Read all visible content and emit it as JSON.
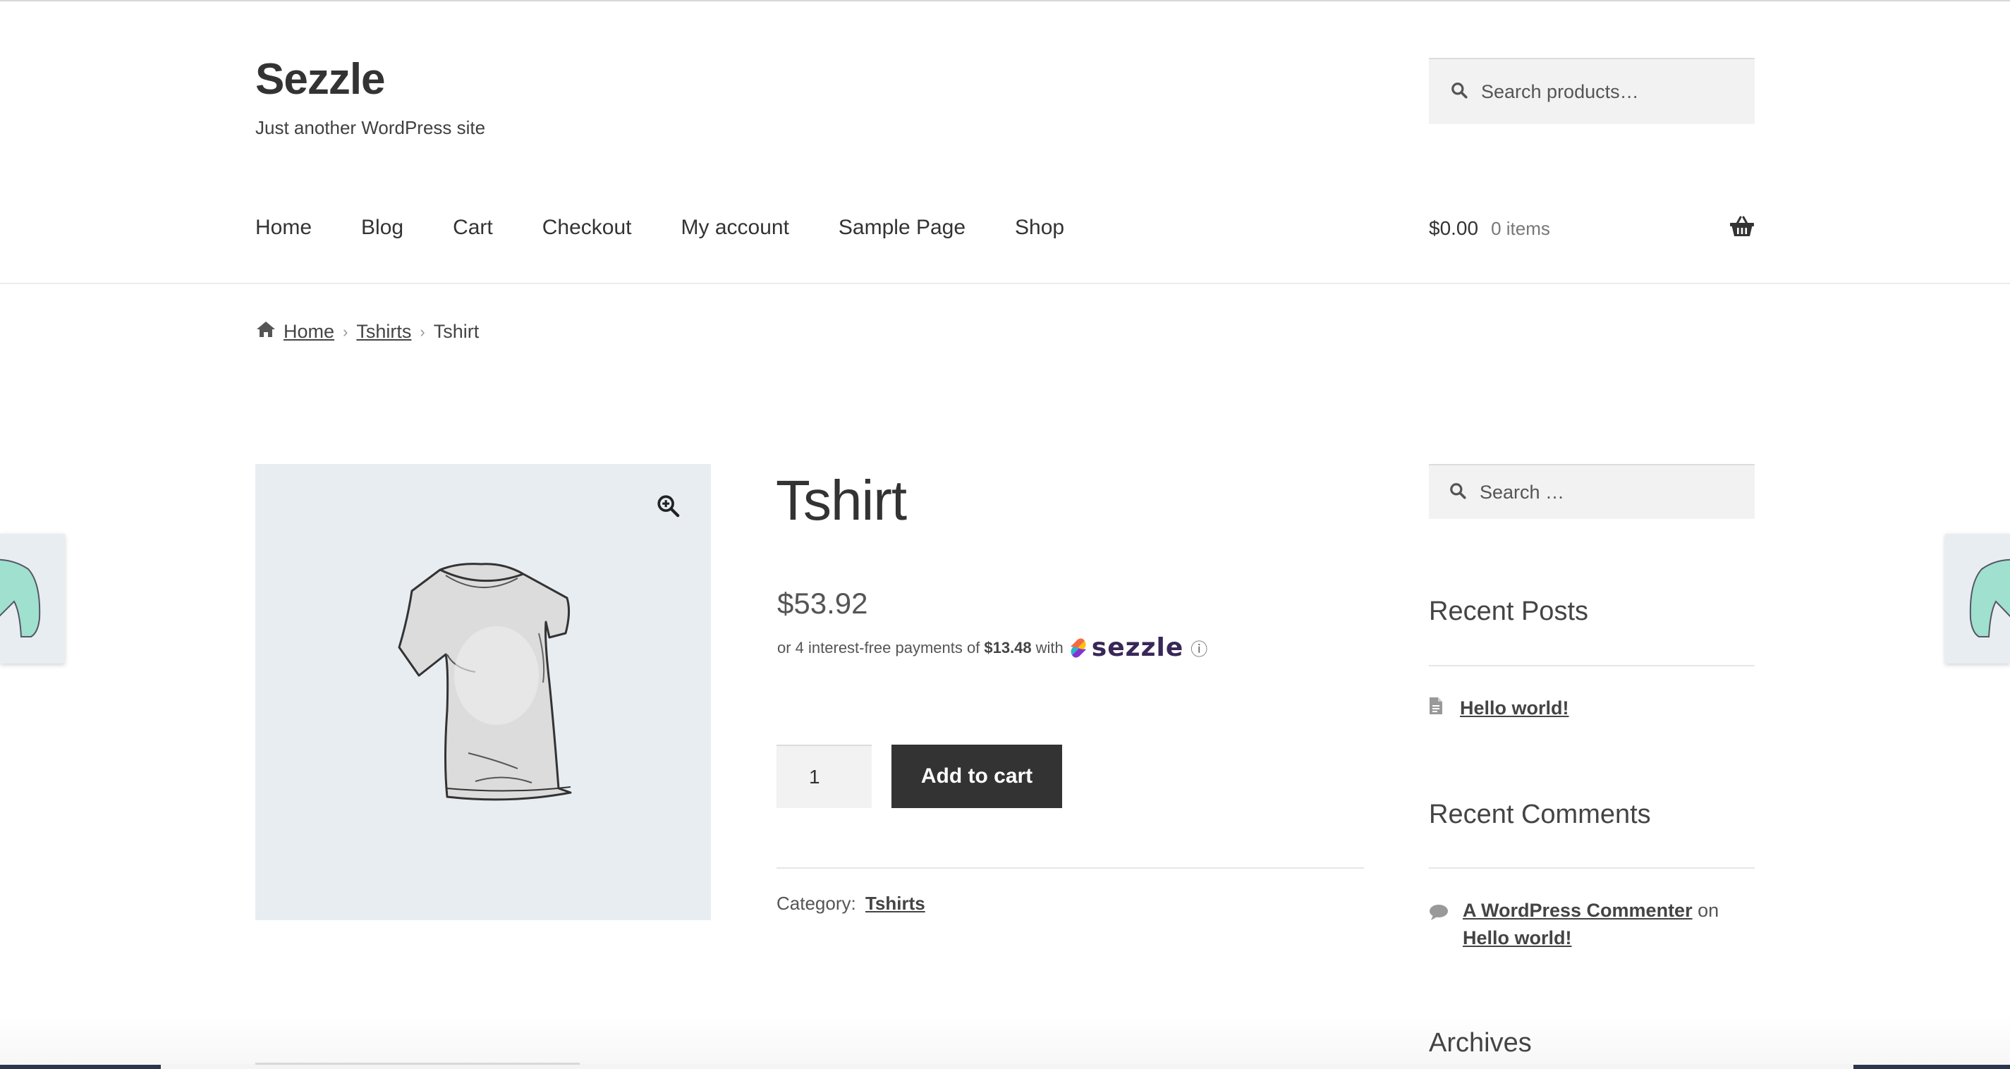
{
  "site": {
    "title": "Sezzle",
    "tagline": "Just another WordPress site"
  },
  "header_search": {
    "placeholder": "Search products…"
  },
  "nav": {
    "items": [
      "Home",
      "Blog",
      "Cart",
      "Checkout",
      "My account",
      "Sample Page",
      "Shop"
    ]
  },
  "cart": {
    "amount": "$0.00",
    "count": "0 items"
  },
  "breadcrumb": {
    "items": [
      "Home",
      "Tshirts"
    ],
    "current": "Tshirt"
  },
  "product": {
    "title": "Tshirt",
    "price": "$53.92",
    "sezzle": {
      "prefix": "or 4 interest-free payments of",
      "installment": "$13.48",
      "with": "with",
      "brand": "sezzle",
      "info": "ⓘ"
    },
    "quantity": "1",
    "add_to_cart": "Add to cart",
    "category_label": "Category:",
    "category": "Tshirts"
  },
  "sidebar": {
    "search_placeholder": "Search …",
    "recent_posts_title": "Recent Posts",
    "recent_posts": [
      "Hello world!"
    ],
    "recent_comments_title": "Recent Comments",
    "comment": {
      "author": "A WordPress Commenter",
      "on": "on",
      "post": "Hello world!"
    },
    "archives_title": "Archives"
  },
  "colors": {
    "accent": "#333333",
    "gallery_bg": "#e8edf2",
    "sezzle_purple": "#382757"
  }
}
